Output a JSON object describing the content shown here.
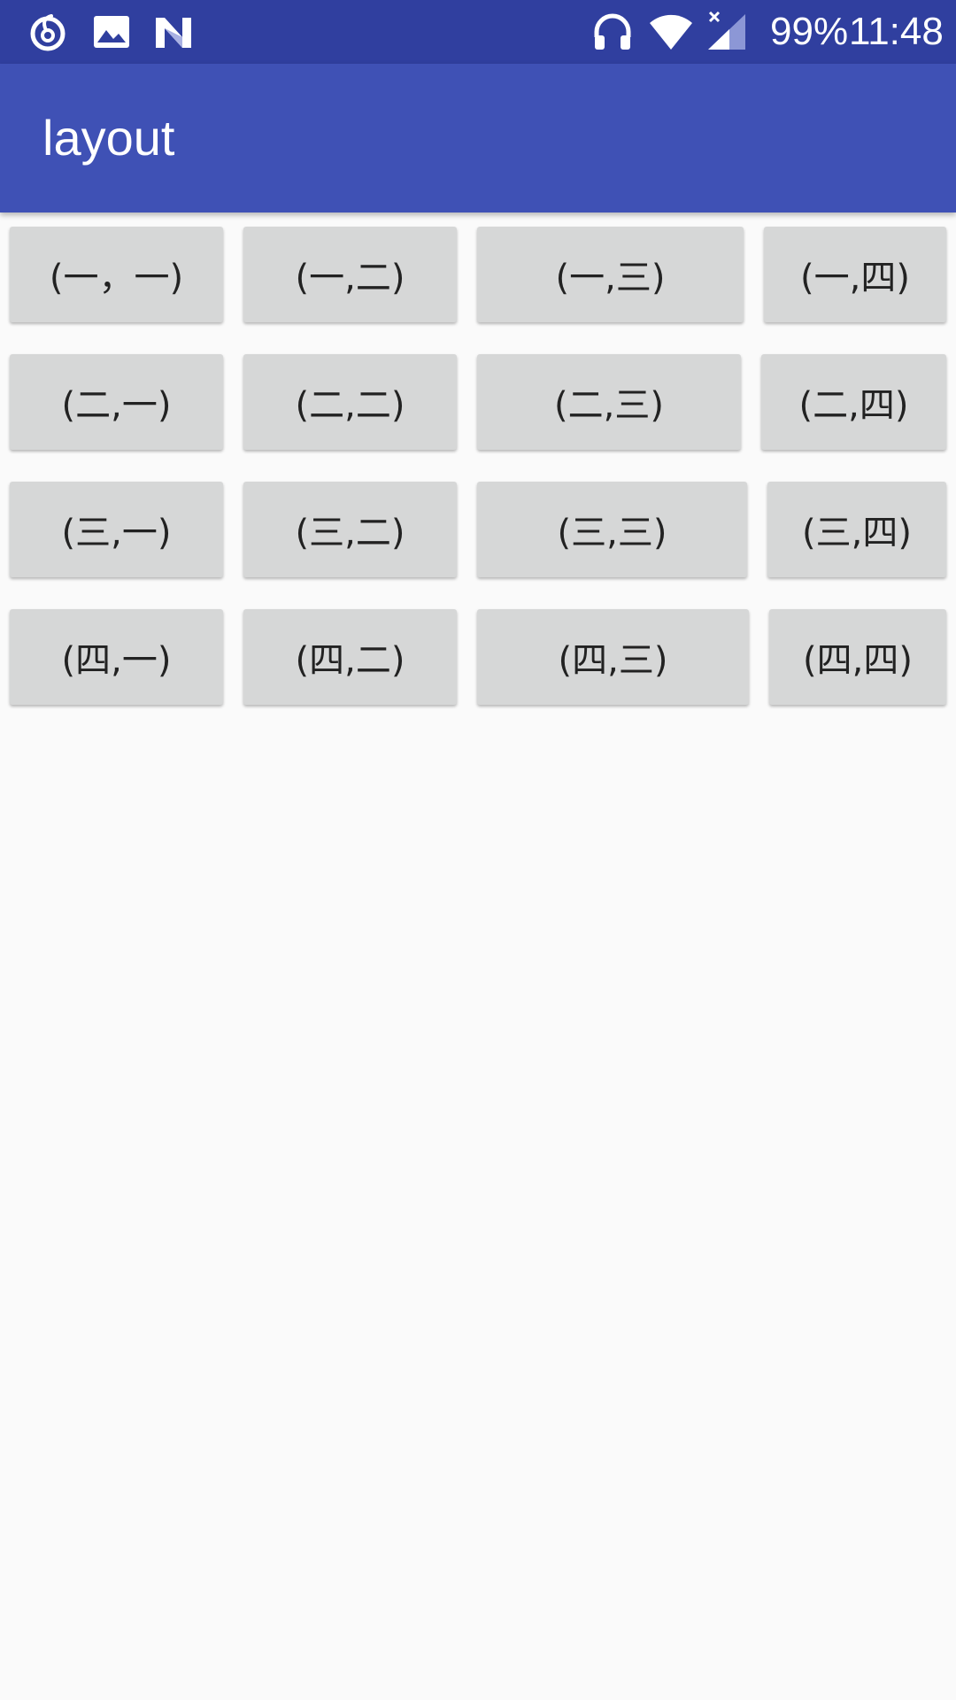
{
  "status_bar": {
    "battery": "99%",
    "time": "11:48",
    "icons": [
      "music-notification-icon",
      "image-notification-icon",
      "n-notification-icon",
      "headphones-icon",
      "wifi-icon",
      "cell-signal-icon"
    ]
  },
  "app_bar": {
    "title": "layout"
  },
  "colors": {
    "status_bar": "#303f9f",
    "app_bar": "#3f51b5",
    "background": "#fafafa",
    "button": "#d6d7d7",
    "button_text": "#222222"
  },
  "grid": {
    "rows": [
      [
        "(一，一)",
        "(一,二)",
        "(一,三)",
        "(一,四)"
      ],
      [
        "(二,一)",
        "(二,二)",
        "(二,三)",
        "(二,四)"
      ],
      [
        "(三,一)",
        "(三,二)",
        "(三,三)",
        "(三,四)"
      ],
      [
        "(四,一)",
        "(四,二)",
        "(四,三)",
        "(四,四)"
      ]
    ]
  }
}
